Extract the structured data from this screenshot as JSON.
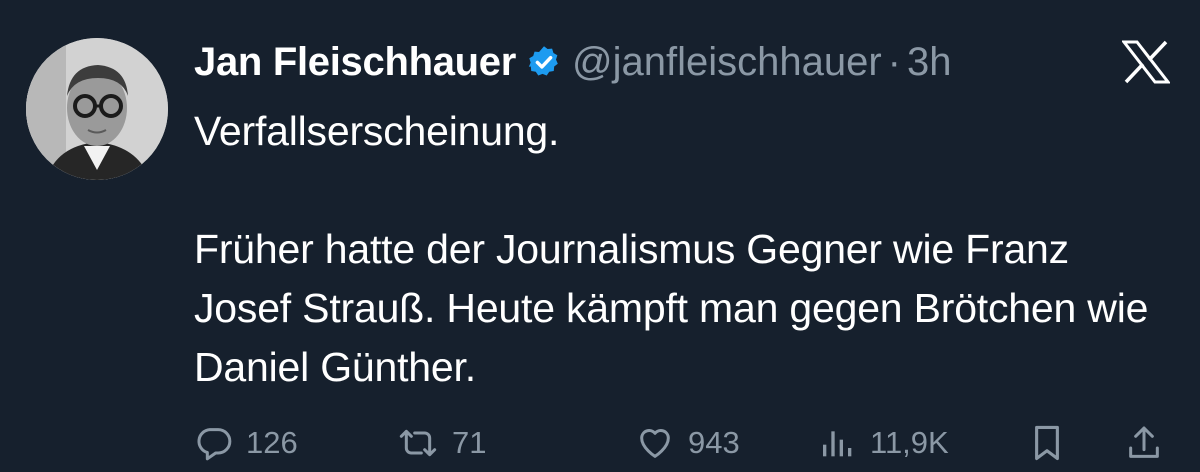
{
  "tweet": {
    "author": {
      "name": "Jan Fleischhauer",
      "handle": "@janfleischhauer",
      "verified": true
    },
    "time": "3h",
    "separator": "·",
    "text": {
      "line1": "Verfallserscheinung.",
      "paragraph2": "Früher hatte der Journalismus Gegner wie Franz Josef Strauß. Heute kämpft man gegen Brötchen wie Daniel Günther."
    },
    "metrics": {
      "replies": "126",
      "reposts": "71",
      "likes": "943",
      "views": "11,9K"
    }
  },
  "colors": {
    "background": "#16202d",
    "text_primary": "#ffffff",
    "text_secondary": "#8b98a5",
    "verified_badge": "#1d9bf0"
  },
  "icons": {
    "platform_logo": "x-logo-icon",
    "verified": "verified-badge-icon",
    "reply": "reply-icon",
    "repost": "repost-icon",
    "like": "heart-icon",
    "views": "views-icon",
    "bookmark": "bookmark-icon",
    "share": "share-icon"
  }
}
